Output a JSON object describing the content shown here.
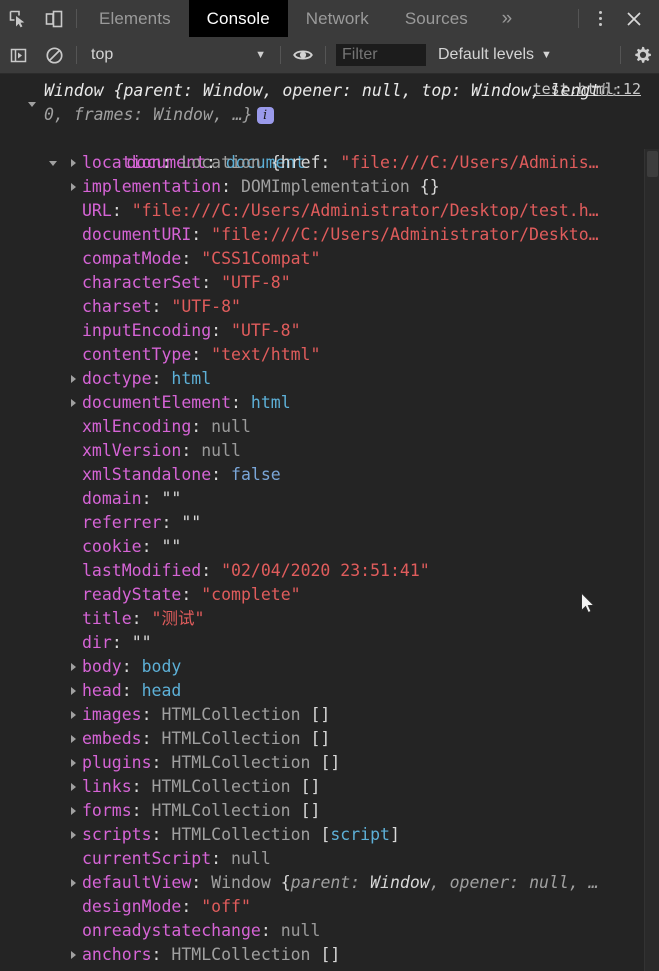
{
  "toolbar": {
    "inspect_icon": "inspect-element-icon",
    "device_icon": "device-toolbar-icon",
    "tabs": [
      {
        "label": "Elements",
        "active": false
      },
      {
        "label": "Console",
        "active": true
      },
      {
        "label": "Network",
        "active": false
      },
      {
        "label": "Sources",
        "active": false
      }
    ],
    "more_tabs_label": "»",
    "menu_icon": "kebab-menu-icon",
    "close_label": "✕"
  },
  "filterbar": {
    "sidebar_toggle_icon": "console-sidebar-icon",
    "clear_icon": "clear-console-icon",
    "context": "top",
    "context_caret": "▼",
    "eye_icon": "live-expression-eye-icon",
    "filter_placeholder": "Filter",
    "filter_value": "",
    "levels_label": "Default levels",
    "levels_caret": "▼",
    "settings_icon": "settings-gear-icon"
  },
  "console": {
    "source_link": "test.html:12",
    "window_header": {
      "type": "Window",
      "text_line1": "Window {parent: Window, opener: null, top: Window, lengt",
      "text_line2": "h: 0, frames: Window, …}",
      "badge": "i",
      "expanded": true
    },
    "document_row": {
      "key": "document",
      "value": "document",
      "expanded": true
    },
    "properties": [
      {
        "arrow": "collapsed",
        "key": "location",
        "type": "Location",
        "value": "{href: \"file:///C:/Users/Adminis…",
        "value_kind": "preview-string"
      },
      {
        "arrow": "collapsed",
        "key": "implementation",
        "type": "DOMImplementation",
        "value": "{}",
        "value_kind": "preview"
      },
      {
        "arrow": "none",
        "key": "URL",
        "type": "",
        "value": "\"file:///C:/Users/Administrator/Desktop/test.h…",
        "value_kind": "string"
      },
      {
        "arrow": "none",
        "key": "documentURI",
        "type": "",
        "value": "\"file:///C:/Users/Administrator/Deskto…",
        "value_kind": "string"
      },
      {
        "arrow": "none",
        "key": "compatMode",
        "type": "",
        "value": "\"CSS1Compat\"",
        "value_kind": "string"
      },
      {
        "arrow": "none",
        "key": "characterSet",
        "type": "",
        "value": "\"UTF-8\"",
        "value_kind": "string"
      },
      {
        "arrow": "none",
        "key": "charset",
        "type": "",
        "value": "\"UTF-8\"",
        "value_kind": "string"
      },
      {
        "arrow": "none",
        "key": "inputEncoding",
        "type": "",
        "value": "\"UTF-8\"",
        "value_kind": "string"
      },
      {
        "arrow": "none",
        "key": "contentType",
        "type": "",
        "value": "\"text/html\"",
        "value_kind": "string"
      },
      {
        "arrow": "collapsed",
        "key": "doctype",
        "type": "",
        "value": "html",
        "value_kind": "node"
      },
      {
        "arrow": "collapsed",
        "key": "documentElement",
        "type": "",
        "value": "html",
        "value_kind": "node"
      },
      {
        "arrow": "none",
        "key": "xmlEncoding",
        "type": "",
        "value": "null",
        "value_kind": "null"
      },
      {
        "arrow": "none",
        "key": "xmlVersion",
        "type": "",
        "value": "null",
        "value_kind": "null"
      },
      {
        "arrow": "none",
        "key": "xmlStandalone",
        "type": "",
        "value": "false",
        "value_kind": "boolean"
      },
      {
        "arrow": "none",
        "key": "domain",
        "type": "",
        "value": "\"\"",
        "value_kind": "empty-string"
      },
      {
        "arrow": "none",
        "key": "referrer",
        "type": "",
        "value": "\"\"",
        "value_kind": "empty-string"
      },
      {
        "arrow": "none",
        "key": "cookie",
        "type": "",
        "value": "\"\"",
        "value_kind": "empty-string"
      },
      {
        "arrow": "none",
        "key": "lastModified",
        "type": "",
        "value": "\"02/04/2020 23:51:41\"",
        "value_kind": "string"
      },
      {
        "arrow": "none",
        "key": "readyState",
        "type": "",
        "value": "\"complete\"",
        "value_kind": "string"
      },
      {
        "arrow": "none",
        "key": "title",
        "type": "",
        "value": "\"测试\"",
        "value_kind": "string"
      },
      {
        "arrow": "none",
        "key": "dir",
        "type": "",
        "value": "\"\"",
        "value_kind": "empty-string"
      },
      {
        "arrow": "collapsed",
        "key": "body",
        "type": "",
        "value": "body",
        "value_kind": "node"
      },
      {
        "arrow": "collapsed",
        "key": "head",
        "type": "",
        "value": "head",
        "value_kind": "node"
      },
      {
        "arrow": "collapsed",
        "key": "images",
        "type": "HTMLCollection",
        "value": "[]",
        "value_kind": "collection"
      },
      {
        "arrow": "collapsed",
        "key": "embeds",
        "type": "HTMLCollection",
        "value": "[]",
        "value_kind": "collection"
      },
      {
        "arrow": "collapsed",
        "key": "plugins",
        "type": "HTMLCollection",
        "value": "[]",
        "value_kind": "collection"
      },
      {
        "arrow": "collapsed",
        "key": "links",
        "type": "HTMLCollection",
        "value": "[]",
        "value_kind": "collection"
      },
      {
        "arrow": "collapsed",
        "key": "forms",
        "type": "HTMLCollection",
        "value": "[]",
        "value_kind": "collection"
      },
      {
        "arrow": "collapsed",
        "key": "scripts",
        "type": "HTMLCollection",
        "value": "[script]",
        "value_kind": "collection-node"
      },
      {
        "arrow": "none",
        "key": "currentScript",
        "type": "",
        "value": "null",
        "value_kind": "null"
      },
      {
        "arrow": "collapsed",
        "key": "defaultView",
        "type": "Window",
        "value": "{parent: Window, opener: null, …",
        "value_kind": "preview-window"
      },
      {
        "arrow": "none",
        "key": "designMode",
        "type": "",
        "value": "\"off\"",
        "value_kind": "string"
      },
      {
        "arrow": "none",
        "key": "onreadystatechange",
        "type": "",
        "value": "null",
        "value_kind": "null"
      },
      {
        "arrow": "collapsed",
        "key": "anchors",
        "type": "HTMLCollection",
        "value": "[]",
        "value_kind": "collection"
      }
    ]
  },
  "colors": {
    "background": "#242424",
    "toolbar": "#3b3b3b",
    "active_tab": "#000000",
    "property_key": "#d664d6",
    "string_value": "#e05c5c",
    "node_value": "#5db0d7",
    "boolean_value": "#7aa6d8",
    "null_value": "#9a9a9a",
    "type_name": "#a0a0a0",
    "badge": "#9a9aeb"
  }
}
